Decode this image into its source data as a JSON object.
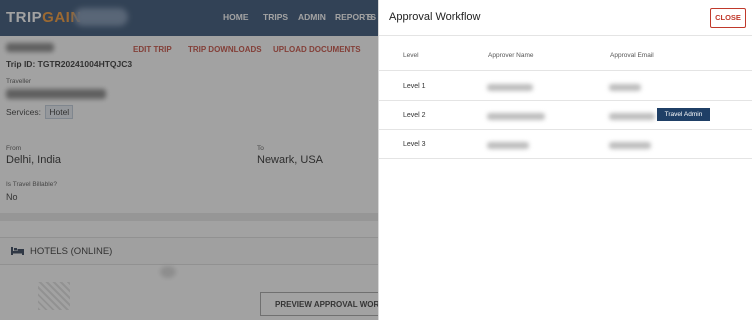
{
  "app": {
    "logo_part1": "TRIP",
    "logo_part2": "GAIN",
    "nav": {
      "home": "HOME",
      "trips": "TRIPS",
      "admin": "ADMIN",
      "reports": "REPORTS",
      "more": "S"
    },
    "trip_actions": {
      "edit": "EDIT TRIP",
      "downloads": "TRIP DOWNLOADS",
      "upload": "UPLOAD DOCUMENTS"
    },
    "trip_id": "Trip ID: TGTR20241004HTQJC3",
    "traveller_label": "Traveller",
    "services_label": "Services:",
    "services_value": "Hotel",
    "from_label": "From",
    "from_city": "Delhi, India",
    "to_label": "To",
    "to_city": "Newark, USA",
    "billable_label": "Is Travel Billable?",
    "billable_value": "No",
    "hotels_section": "HOTELS (ONLINE)",
    "preview_button": "PREVIEW APPROVAL WORKF"
  },
  "panel": {
    "title": "Approval Workflow",
    "close_label": "CLOSE",
    "columns": {
      "level": "Level",
      "approver_name": "Approver Name",
      "approval_email": "Approval Email"
    },
    "rows": [
      {
        "level": "Level 1"
      },
      {
        "level": "Level 2",
        "badge": "Travel Admin"
      },
      {
        "level": "Level 3"
      }
    ]
  },
  "colors": {
    "navbar": "#1f3f66",
    "accent_red": "#c0392b",
    "logo_orange": "#f08c1e",
    "badge_bg": "#1f3f66"
  }
}
